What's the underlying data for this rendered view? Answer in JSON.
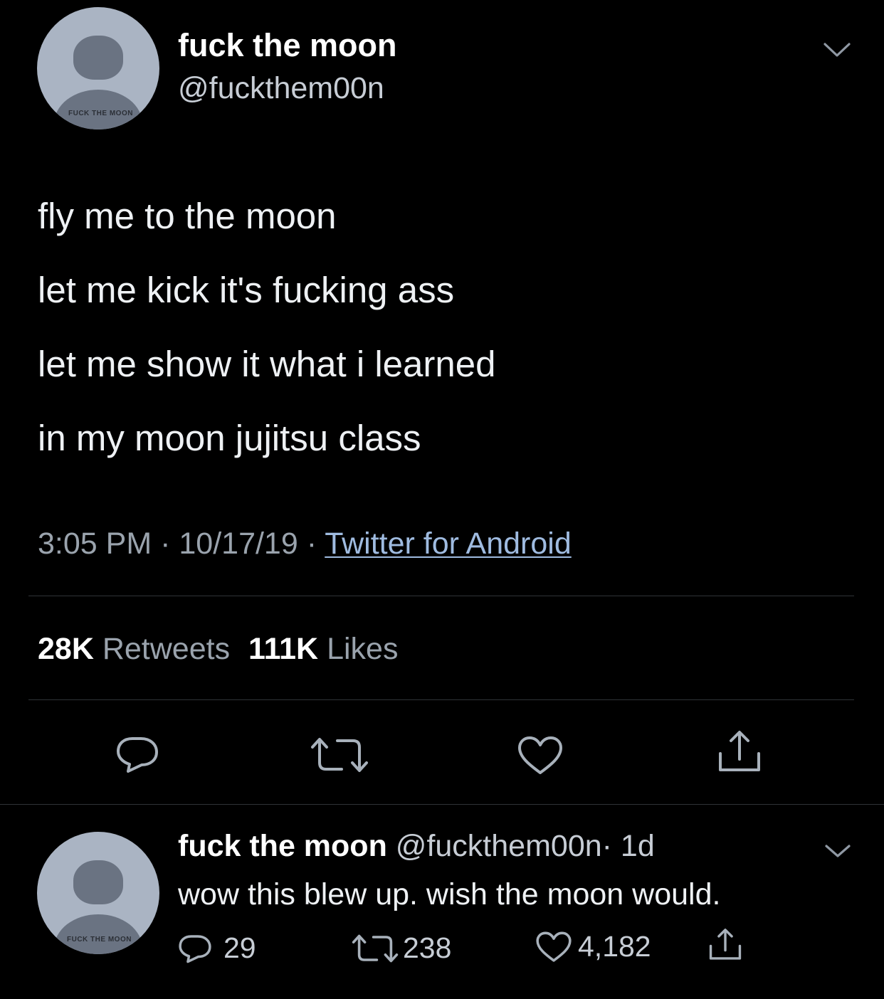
{
  "tweet": {
    "avatar_text": "FUCK THE MOON",
    "display_name": "fuck the moon",
    "handle": "@fuckthem00n",
    "lines": [
      "fly me to the moon",
      "let me kick it's fucking ass",
      "let me show it what i learned",
      "in my moon jujitsu class"
    ],
    "time": "3:05 PM",
    "date": "10/17/19",
    "separator": "·",
    "source": "Twitter for Android",
    "retweets_count": "28K",
    "retweets_label": "Retweets",
    "likes_count": "111K",
    "likes_label": "Likes"
  },
  "reply": {
    "avatar_text": "FUCK THE MOON",
    "display_name": "fuck the moon",
    "handle": "@fuckthem00n",
    "age": "· 1d",
    "text": "wow this blew up. wish the moon would.",
    "replies": "29",
    "retweets": "238",
    "likes": "4,182"
  },
  "icons": {
    "reply": "reply-icon",
    "retweet": "retweet-icon",
    "like": "heart-icon",
    "share": "share-icon",
    "menu": "chevron-down-icon"
  },
  "colors": {
    "background": "#000000",
    "text": "#ffffff",
    "muted": "#9aa3ad",
    "link": "#9fbbe0",
    "divider": "#2f3337"
  }
}
